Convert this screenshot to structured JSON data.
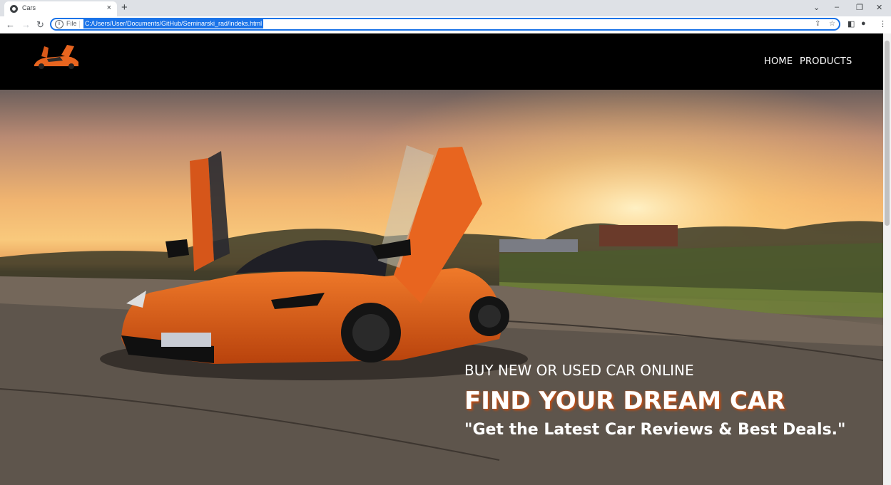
{
  "browser": {
    "tab_title": "Cars",
    "new_tab": "+",
    "close": "×",
    "scheme": "File",
    "url": "C:/Users/User/Documents/GitHub/Seminarski_rad/indeks.html"
  },
  "site": {
    "nav": [
      "HOME",
      "PRODUCTS"
    ]
  },
  "hero": {
    "line1": "BUY NEW OR USED CAR ONLINE",
    "line2": "FIND YOUR DREAM CAR",
    "line3": "\"Get the Latest Car Reviews & Best Deals.\""
  },
  "colors": {
    "header_bg": "#000000",
    "car": "#e8651f",
    "accent": "#1a73e8"
  }
}
